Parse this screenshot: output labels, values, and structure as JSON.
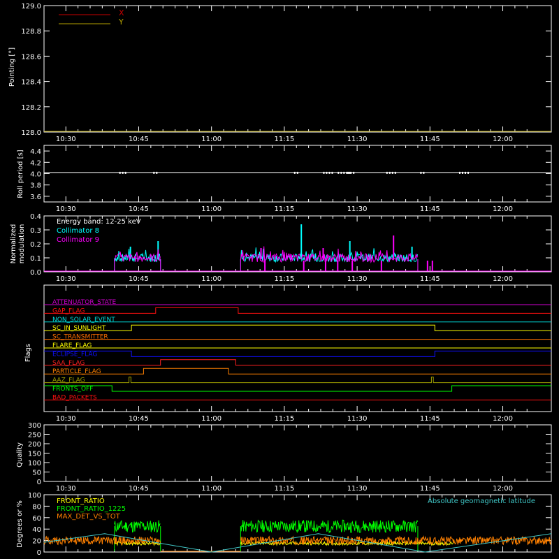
{
  "time_axis": {
    "tick_labels": [
      "10:30",
      "10:45",
      "11:00",
      "11:15",
      "11:30",
      "11:45",
      "12:00"
    ],
    "tick_values_min": [
      30,
      45,
      60,
      75,
      90,
      105,
      120
    ],
    "start_min": 25.5,
    "end_min": 130.0
  },
  "colors": {
    "background": "#000000",
    "axes": "#ffffff",
    "x_pointing": "#c80000",
    "y_pointing": "#b4a000",
    "collimator8": "#00ffff",
    "collimator9": "#ff00ff",
    "front_ratio": "#ffff00",
    "front_ratio_1225": "#00ff00",
    "max_det_vs_tot": "#ff8000",
    "geomag": "#40c8c8"
  },
  "chart_data": [
    {
      "type": "line",
      "ylabel": "Pointing [°]",
      "ylim": [
        128.0,
        129.0
      ],
      "yticks": [
        "128.0",
        "128.2",
        "128.4",
        "128.6",
        "128.8",
        "129.0"
      ],
      "legend": [
        "X",
        "Y"
      ],
      "series": [
        {
          "name": "X",
          "values": []
        },
        {
          "name": "Y",
          "values": [
            [
              25.5,
              128.0
            ],
            [
              130.0,
              128.0
            ]
          ]
        }
      ]
    },
    {
      "type": "line",
      "ylabel": "Roll period [s]",
      "ylim": [
        3.5,
        4.5
      ],
      "yticks": [
        "3.6",
        "3.8",
        "4.0",
        "4.2",
        "4.4"
      ],
      "series": [
        {
          "name": "",
          "values": [
            [
              25.5,
              4.02
            ],
            [
              130.0,
              4.02
            ]
          ]
        }
      ]
    },
    {
      "type": "line",
      "ylabel": "Normalized modulation",
      "ylim": [
        0.0,
        0.4
      ],
      "yticks": [
        "0.0",
        "0.1",
        "0.2",
        "0.3",
        "0.4"
      ],
      "annotations": [
        "Energy band: 12-25 keV"
      ],
      "legend": [
        "Collimator 8",
        "Collimator 9"
      ],
      "series": [
        {
          "name": "Collimator 8",
          "segments": [
            [
              40.0,
              49.5
            ],
            [
              66.0,
              102.5
            ]
          ],
          "peaks": [
            [
              78.5,
              0.34
            ],
            [
              43.3,
              0.18
            ],
            [
              49.0,
              0.22
            ],
            [
              88.5,
              0.22
            ],
            [
              101.3,
              0.18
            ]
          ]
        },
        {
          "name": "Collimator 9",
          "segments": [
            [
              40.0,
              49.5
            ],
            [
              66.0,
              102.5
            ]
          ],
          "peaks": [
            [
              97.5,
              0.26
            ],
            [
              83.0,
              0.17
            ],
            [
              70.2,
              0.17
            ]
          ]
        }
      ]
    },
    {
      "type": "line",
      "ylabel": "Flags",
      "flags": [
        {
          "name": "ATTENUATOR_STATE",
          "color": "#d000d0",
          "transitions": [],
          "start_high": false
        },
        {
          "name": "GAP_FLAG",
          "color": "#ff1010",
          "transitions": [
            [
              48.5,
              1
            ],
            [
              65.5,
              0
            ]
          ],
          "start_high": false
        },
        {
          "name": "NON_SOLAR_EVENT",
          "color": "#00e0e0",
          "transitions": [],
          "start_high": false
        },
        {
          "name": "SC_IN_SUNLIGHT",
          "color": "#ffff00",
          "transitions": [
            [
              43.5,
              1
            ],
            [
              106.0,
              0
            ]
          ],
          "start_high": false
        },
        {
          "name": "SC_TRANSMITTER",
          "color": "#ff7000",
          "transitions": [],
          "start_high": false
        },
        {
          "name": "FLARE_FLAG",
          "color": "#ffff00",
          "transitions": [],
          "start_high": false
        },
        {
          "name": "ECLIPSE_FLAG",
          "color": "#1010ff",
          "transitions": [
            [
              43.5,
              0
            ],
            [
              106.0,
              1
            ]
          ],
          "start_high": true
        },
        {
          "name": "SAA_FLAG",
          "color": "#ff2020",
          "transitions": [
            [
              49.5,
              1
            ],
            [
              65.0,
              0
            ]
          ],
          "start_high": false
        },
        {
          "name": "PARTICLE_FLAG",
          "color": "#ff8000",
          "transitions": [
            [
              46.0,
              1
            ],
            [
              63.5,
              0
            ]
          ],
          "start_high": false
        },
        {
          "name": "AAZ_FLAG",
          "color": "#a0a000",
          "transitions": [
            [
              43.0,
              1
            ],
            [
              43.4,
              0
            ],
            [
              105.3,
              1
            ],
            [
              105.7,
              0
            ]
          ],
          "start_high": false
        },
        {
          "name": "FRONTS_OFF",
          "color": "#00ff00",
          "transitions": [
            [
              39.5,
              0
            ],
            [
              109.5,
              1
            ]
          ],
          "start_high": true
        },
        {
          "name": "BAD_PACKETS",
          "color": "#ff1010",
          "transitions": [],
          "start_high": false
        }
      ]
    },
    {
      "type": "line",
      "ylabel": "Quality",
      "ylim": [
        0,
        300
      ],
      "yticks": [
        "0",
        "50",
        "100",
        "150",
        "200",
        "250",
        "300"
      ],
      "series": []
    },
    {
      "type": "line",
      "ylabel": "Degrees or %",
      "ylim": [
        0,
        100
      ],
      "yticks": [
        "0",
        "20",
        "40",
        "60",
        "80",
        "100"
      ],
      "legend": [
        "FRONT_RATIO",
        "FRONT_RATIO_1225",
        "MAX_DET_VS_TOT"
      ],
      "annotation_right": "Absolute geomagnetic latitude",
      "series": [
        {
          "name": "FRONT_RATIO",
          "segments": [
            [
              40.0,
              49.5
            ],
            [
              66.0,
              110.0
            ]
          ],
          "level": 15
        },
        {
          "name": "FRONT_RATIO_1225",
          "segments": [
            [
              40.0,
              49.5
            ],
            [
              66.0,
              102.5
            ]
          ],
          "level": 45
        },
        {
          "name": "MAX_DET_VS_TOT",
          "segments": [
            [
              25.5,
              40.0
            ],
            [
              40.0,
              49.5
            ],
            [
              66.0,
              130.0
            ]
          ],
          "level": 20
        },
        {
          "name": "Absolute geomagnetic latitude",
          "values": [
            [
              25.5,
              17
            ],
            [
              38.0,
              32
            ],
            [
              60.0,
              0
            ],
            [
              82.0,
              32
            ],
            [
              104.0,
              0
            ],
            [
              130.0,
              32
            ]
          ]
        }
      ]
    }
  ]
}
